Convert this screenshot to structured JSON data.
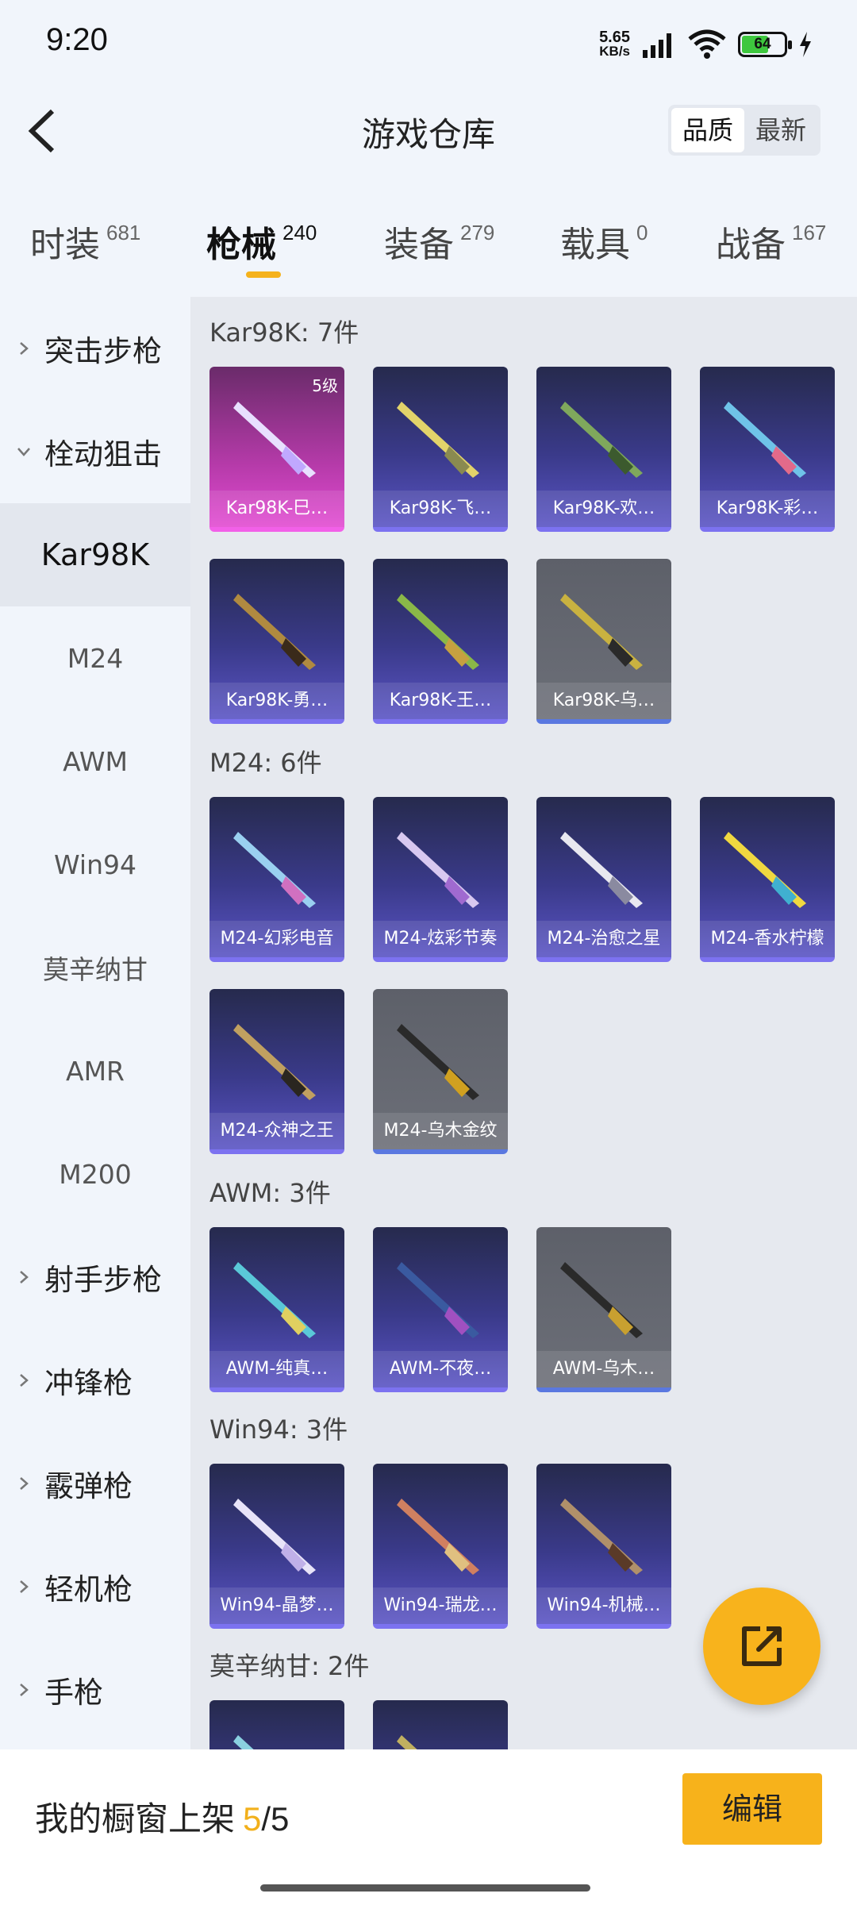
{
  "status": {
    "time": "9:20",
    "speed_value": "5.65",
    "speed_unit": "KB/s",
    "battery": "64"
  },
  "header": {
    "title": "游戏仓库",
    "sort_options": [
      "品质",
      "最新"
    ]
  },
  "categories": [
    {
      "name": "时装",
      "count": "681"
    },
    {
      "name": "枪械",
      "count": "240"
    },
    {
      "name": "装备",
      "count": "279"
    },
    {
      "name": "载具",
      "count": "0"
    },
    {
      "name": "战备",
      "count": "167"
    }
  ],
  "sidebar": {
    "items": [
      {
        "label": "突击步枪"
      },
      {
        "label": "栓动狙击"
      },
      {
        "label": "Kar98K"
      },
      {
        "label": "M24"
      },
      {
        "label": "AWM"
      },
      {
        "label": "Win94"
      },
      {
        "label": "莫辛纳甘"
      },
      {
        "label": "AMR"
      },
      {
        "label": "M200"
      },
      {
        "label": "射手步枪"
      },
      {
        "label": "冲锋枪"
      },
      {
        "label": "霰弹枪"
      },
      {
        "label": "轻机枪"
      },
      {
        "label": "手枪"
      }
    ]
  },
  "sections": [
    {
      "title": "Kar98K: 7件",
      "items": [
        {
          "label": "Kar98K-巳…",
          "level": "5级"
        },
        {
          "label": "Kar98K-飞…"
        },
        {
          "label": "Kar98K-欢…"
        },
        {
          "label": "Kar98K-彩…"
        },
        {
          "label": "Kar98K-勇…"
        },
        {
          "label": "Kar98K-王…"
        },
        {
          "label": "Kar98K-乌…"
        }
      ]
    },
    {
      "title": "M24: 6件",
      "items": [
        {
          "label": "M24-幻彩电音"
        },
        {
          "label": "M24-炫彩节奏"
        },
        {
          "label": "M24-治愈之星"
        },
        {
          "label": "M24-香水柠檬"
        },
        {
          "label": "M24-众神之王"
        },
        {
          "label": "M24-乌木金纹"
        }
      ]
    },
    {
      "title": "AWM: 3件",
      "items": [
        {
          "label": "AWM-纯真…"
        },
        {
          "label": "AWM-不夜…"
        },
        {
          "label": "AWM-乌木…"
        }
      ]
    },
    {
      "title": "Win94: 3件",
      "items": [
        {
          "label": "Win94-晶梦…"
        },
        {
          "label": "Win94-瑞龙…"
        },
        {
          "label": "Win94-机械…"
        }
      ]
    },
    {
      "title": "莫辛纳甘: 2件",
      "items": []
    }
  ],
  "bottom": {
    "showcase_label": "我的橱窗上架",
    "current": "5",
    "separator": "/",
    "max": "5",
    "edit_label": "编辑"
  }
}
